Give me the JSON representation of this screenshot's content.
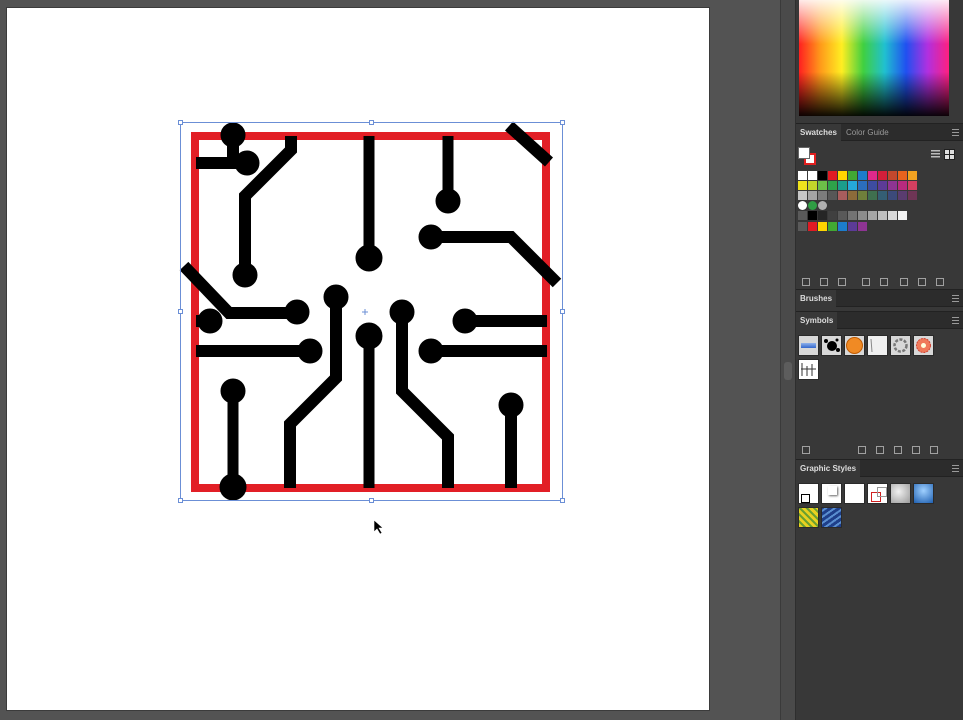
{
  "colors": {
    "board_outline": "#e21f26",
    "traces": "#000000",
    "selection": "#6b8fd6",
    "spectrum_hues": [
      "#ff2020",
      "#ff9a1a",
      "#ffee22",
      "#40d040",
      "#20c0d0",
      "#2050f0",
      "#b030e0",
      "#ff2080"
    ]
  },
  "panels": {
    "swatches": {
      "tabs": [
        "Swatches",
        "Color Guide"
      ],
      "active_tab": "Swatches"
    },
    "brushes": {
      "title": "Brushes"
    },
    "symbols": {
      "title": "Symbols"
    },
    "graphic_styles": {
      "title": "Graphic Styles"
    }
  },
  "swatch_colors": [
    [
      "#ffffff",
      "#ffffff",
      "#000000",
      "#e01b24",
      "#ffd500",
      "#41a833",
      "#1c7ccc",
      "#e0298b",
      "#d31f3a",
      "#c2482d",
      "#e8631e",
      "#f2a221"
    ],
    [
      "#f0e41d",
      "#c3d62b",
      "#6cbf48",
      "#2ea24a",
      "#1b9d8c",
      "#25a8d9",
      "#2b6ebd",
      "#3d4ca0",
      "#5c3b97",
      "#8e3493",
      "#b72a7e",
      "#d33f60"
    ],
    [
      "#c7c7c7",
      "#a4a4a4",
      "#7c7c7c",
      "#575757",
      "#a85d5d",
      "#8d6b3a",
      "#6f7f3b",
      "#3f6f4f",
      "#345e74",
      "#3c4a7a",
      "#5a3c6f",
      "#6e3555"
    ],
    [
      "#000000",
      "#262626",
      "#404040",
      "#595959",
      "#737373",
      "#8c8c8c",
      "#a6a6a6",
      "#bfbfbf",
      "#d9d9d9",
      "#f2f2f2"
    ],
    [
      "#e01b24",
      "#ffd500",
      "#41a833",
      "#1c7ccc",
      "#5c3b97",
      "#8e3493"
    ]
  ],
  "symbol_icons": [
    "blue-ribbon-icon",
    "ink-splat-icon",
    "orange-circle-icon",
    "swoosh-icon",
    "ring-icon",
    "flower-icon",
    "chart-icon"
  ],
  "graphic_style_icons": [
    "default-style-icon",
    "shadow-style-icon",
    "white-style-icon",
    "red-line-style-icon",
    "bevel-style-icon",
    "blue-gloss-style-icon",
    "yellow-pattern-style-icon",
    "blue-texture-style-icon"
  ]
}
